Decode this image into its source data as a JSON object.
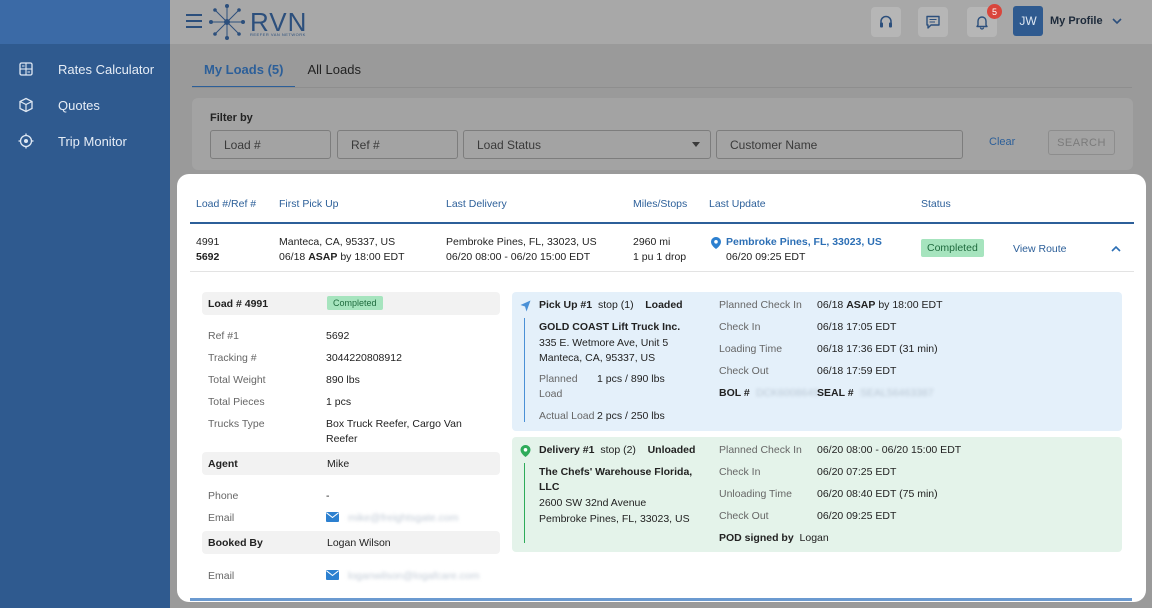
{
  "sidebar": {
    "items": [
      {
        "label": "Rates Calculator",
        "icon": "calculator-icon"
      },
      {
        "label": "Quotes",
        "icon": "cube-icon"
      },
      {
        "label": "Trip Monitor",
        "icon": "radar-icon"
      }
    ]
  },
  "header": {
    "logo_text": "RVN",
    "logo_sub": "REEFER VAN NETWORK",
    "notifications_count": "5",
    "avatar_initials": "JW",
    "profile_label": "My Profile"
  },
  "tabs": [
    {
      "label": "My Loads (5)",
      "active": true
    },
    {
      "label": "All Loads",
      "active": false
    }
  ],
  "filter": {
    "title": "Filter by",
    "load_placeholder": "Load #",
    "ref_placeholder": "Ref #",
    "status_placeholder": "Load Status",
    "customer_placeholder": "Customer Name",
    "clear_label": "Clear",
    "search_label": "SEARCH"
  },
  "table": {
    "headers": [
      "Load #/Ref #",
      "First Pick Up",
      "Last Delivery",
      "Miles/Stops",
      "Last Update",
      "Status"
    ],
    "row": {
      "load": "4991",
      "ref": "5692",
      "pickup_city": "Manteca, CA, 95337, US",
      "pickup_date": "06/18",
      "pickup_asap": "ASAP",
      "pickup_by": "by 18:00 EDT",
      "delivery_city": "Pembroke Pines, FL, 33023, US",
      "delivery_window": "06/20 08:00 - 06/20 15:00 EDT",
      "miles": "2960 mi",
      "stops": "1 pu 1 drop",
      "update_location": "Pembroke Pines, FL, 33023, US",
      "update_time": "06/20 09:25 EDT",
      "status": "Completed",
      "view_route": "View Route"
    }
  },
  "details": {
    "load_title": "Load # 4991",
    "load_status": "Completed",
    "ref_label": "Ref #1",
    "ref_value": "5692",
    "tracking_label": "Tracking #",
    "tracking_value": "3044220808912",
    "weight_label": "Total Weight",
    "weight_value": "890 lbs",
    "pieces_label": "Total Pieces",
    "pieces_value": "1 pcs",
    "trucks_label": "Trucks Type",
    "trucks_value": "Box Truck Reefer, Cargo Van Reefer",
    "agent_label": "Agent",
    "agent_value": "Mike",
    "phone_label": "Phone",
    "phone_value": "-",
    "email_label": "Email",
    "agent_email": "mike@freightsgate.com",
    "booked_label": "Booked By",
    "booked_value": "Logan Wilson",
    "booked_email_label": "Email",
    "booked_email": "loganwilson@logafcare.com"
  },
  "pickup": {
    "title": "Pick Up #1",
    "stop": "stop (1)",
    "state": "Loaded",
    "company": "GOLD COAST Lift Truck Inc.",
    "address1": "335 E. Wetmore Ave, Unit 5",
    "address2": "Manteca, CA, 95337, US",
    "planned_label": "Planned Load",
    "planned_value": "1 pcs / 890 lbs",
    "actual_label": "Actual Load",
    "actual_value": "2 pcs / 250 lbs",
    "pci_label": "Planned Check In",
    "pci_date": "06/18",
    "pci_asap": "ASAP",
    "pci_rest": "by 18:00 EDT",
    "ci_label": "Check In",
    "ci_value": "06/18 17:05 EDT",
    "lt_label": "Loading Time",
    "lt_value": "06/18 17:36 EDT (31 min)",
    "co_label": "Check Out",
    "co_value": "06/18 17:59 EDT",
    "bol_label": "BOL #",
    "bol_value": "DCK6008649",
    "seal_label": "SEAL #",
    "seal_value": "SEAL56463387",
    "accent": "#4a90d6"
  },
  "delivery": {
    "title": "Delivery #1",
    "stop": "stop (2)",
    "state": "Unloaded",
    "company": "The Chefs' Warehouse Florida, LLC",
    "address1": "2600 SW 32nd Avenue",
    "address2": "Pembroke Pines, FL, 33023, US",
    "pci_label": "Planned Check In",
    "pci_value": "06/20 08:00 - 06/20 15:00 EDT",
    "ci_label": "Check In",
    "ci_value": "06/20 07:25 EDT",
    "ut_label": "Unloading Time",
    "ut_value": "06/20 08:40 EDT (75 min)",
    "co_label": "Check Out",
    "co_value": "06/20 09:25 EDT",
    "pod_label": "POD signed by",
    "pod_value": "Logan",
    "accent": "#2eab5a"
  }
}
